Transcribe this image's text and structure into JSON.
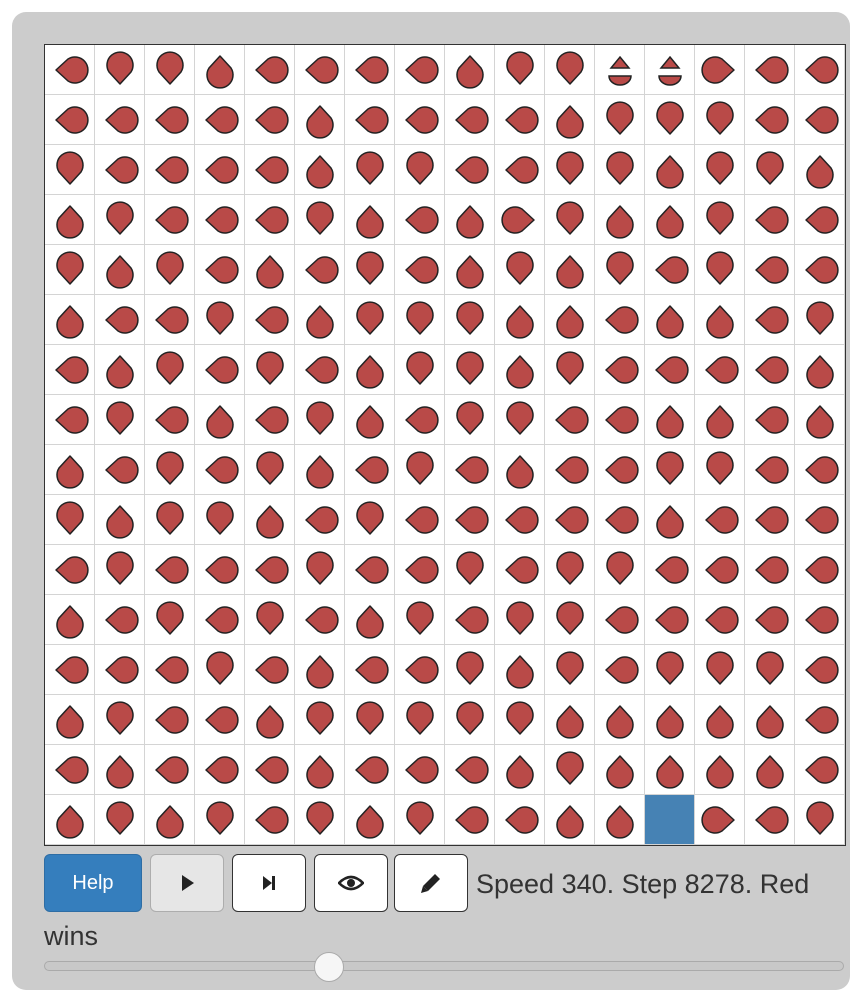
{
  "colors": {
    "red": "#b94a48",
    "blue": "#4682b4",
    "panel": "#cccccc",
    "grid": "#d4d4d4"
  },
  "toolbar": {
    "help_label": "Help",
    "play_icon": "play-icon",
    "step_icon": "step-forward-icon",
    "view_icon": "eye-icon",
    "edit_icon": "pencil-icon"
  },
  "status_text": "Speed 340. Step 8278. Red wins",
  "speed_slider": {
    "value_fraction": 0.35
  },
  "board": {
    "size": 16,
    "legend": "L=left U=up R=right D=down E=empty X=capsule",
    "rows": [
      "LDDULLLLUDDXXRLL",
      "LLLLLULLLLUDDDLL",
      "DLLLLUDDLLDDUDDU",
      "UDLLLDULURDUUDLL",
      "DUDLULDLUDUDLDLL",
      "ULLDLUDDDUULUULD",
      "LUDLDLUDDUDLLLLU",
      "LDLULDULDDLLUULU",
      "ULDLDULDLULLDDLL",
      "DUDDULDLLLLLULLL",
      "LDLLLDLLDLDDLLLL",
      "ULDLDLUDLDDLLLLL",
      "LLLDLULLDUDLDDDL",
      "UDLLUDDDDDUUUUUL",
      "LULLLULLLUDUUUUL",
      "UDUDLDUDLLUUERLD"
    ]
  }
}
